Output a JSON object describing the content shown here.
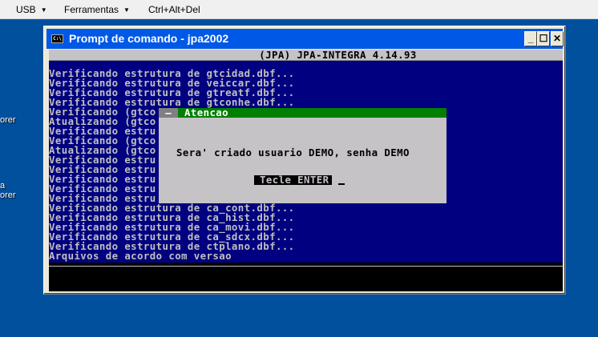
{
  "topbar": {
    "menus": [
      {
        "label": "USB"
      },
      {
        "label": "Ferramentas"
      }
    ],
    "ctrl_alt_del": "Ctrl+Alt+Del"
  },
  "desktop": {
    "icon_labels": [
      "orer",
      "a",
      "orer"
    ]
  },
  "window": {
    "title": "Prompt de comando - jpa2002",
    "icon": "C:\\",
    "buttons": {
      "minimize": "_",
      "maximize": "☐",
      "close": "✕"
    }
  },
  "console": {
    "header": "(JPA) JPA-INTEGRA 4.14.93",
    "lines": [
      "Verificando estrutura de gtcidad.dbf...",
      "Verificando estrutura de veiccar.dbf...",
      "Verificando estrutura de gtreatf.dbf...",
      "Verificando estrutura de gtconhe.dbf...",
      "Verificando (gtco",
      "Atualizando (gtco",
      "Verificando estru",
      "Verificando (gtco",
      "Atualizando (gtco",
      "Verificando estru",
      "Verificando estru",
      "Verificando estru",
      "Verificando estru",
      "Verificando estru",
      "Verificando estrutura de ca_cont.dbf...",
      "Verificando estrutura de ca_hist.dbf...",
      "Verificando estrutura de ca_movi.dbf...",
      "Verificando estrutura de ca_sdcx.dbf...",
      "Verificando estrutura de ctplano.dbf...",
      "Arquivos de acordo com versao"
    ]
  },
  "dialog": {
    "close_glyph": "—",
    "title": "Atencao",
    "message": "Sera' criado usuario DEMO, senha DEMO",
    "prompt": "Tecle ENTER"
  }
}
